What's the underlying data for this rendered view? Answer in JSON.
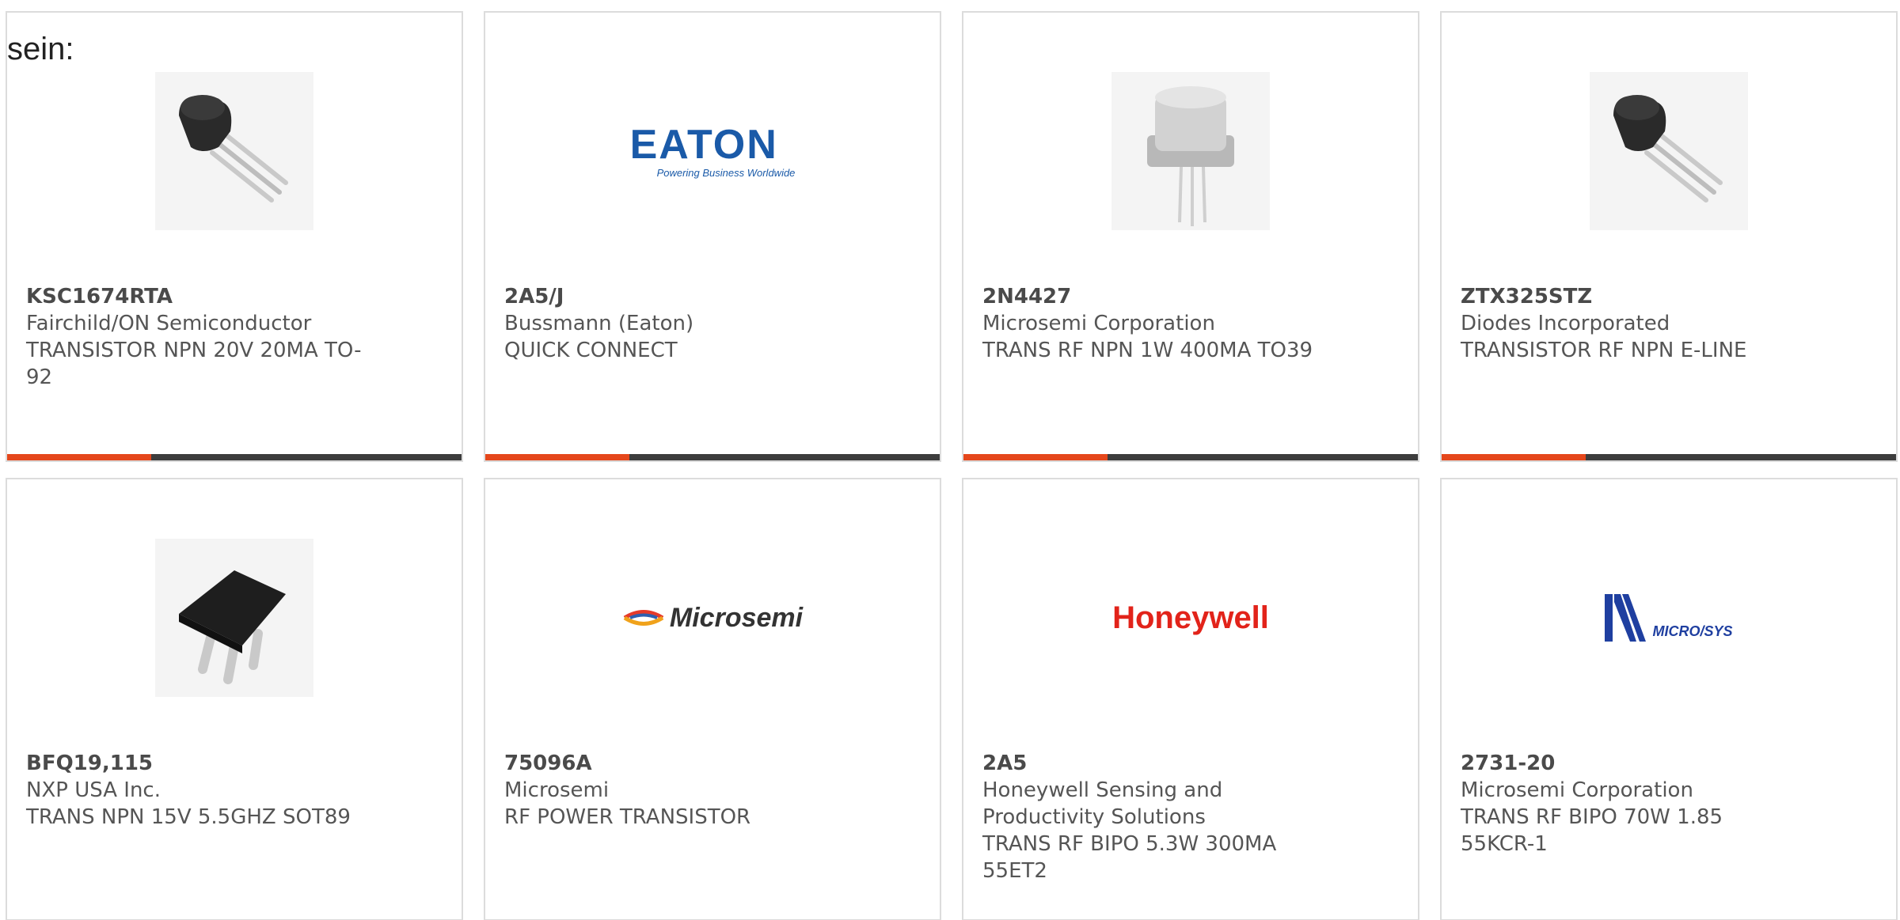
{
  "lead_text": "sein:",
  "colors": {
    "accent": "#e5471b",
    "bar": "#3d3d3d",
    "eaton_blue": "#1a5aa8",
    "honeywell_red": "#e2231a",
    "microsys_blue": "#1f3fa0"
  },
  "products": [
    {
      "part": "KSC1674RTA",
      "manufacturer": "Fairchild/ON Semiconductor",
      "description": "TRANSISTOR NPN 20V 20MA TO-92",
      "image": "to92-transistor-photo"
    },
    {
      "part": "2A5/J",
      "manufacturer": "Bussmann (Eaton)",
      "description": "QUICK CONNECT",
      "image": "eaton-logo",
      "logo_text": "EATON",
      "logo_tagline": "Powering Business Worldwide"
    },
    {
      "part": "2N4427",
      "manufacturer": "Microsemi Corporation",
      "description": "TRANS RF NPN 1W 400MA TO39",
      "image": "to39-transistor-photo"
    },
    {
      "part": "ZTX325STZ",
      "manufacturer": "Diodes Incorporated",
      "description": "TRANSISTOR RF NPN E-LINE",
      "image": "to92-transistor-photo"
    },
    {
      "part": "BFQ19,115",
      "manufacturer": "NXP USA Inc.",
      "description": "TRANS NPN 15V 5.5GHZ SOT89",
      "image": "sot89-transistor-photo"
    },
    {
      "part": "75096A",
      "manufacturer": "Microsemi",
      "description": "RF POWER TRANSISTOR",
      "image": "microsemi-logo",
      "logo_text": "Microsemi"
    },
    {
      "part": "2A5",
      "manufacturer": "Honeywell Sensing and Productivity Solutions",
      "description": "TRANS RF BIPO 5.3W 300MA 55ET2",
      "image": "honeywell-logo",
      "logo_text": "Honeywell"
    },
    {
      "part": "2731-20",
      "manufacturer": "Microsemi Corporation",
      "description": "TRANS RF BIPO 70W 1.85 55KCR-1",
      "image": "microsys-logo",
      "logo_text": "MICRO/SYS"
    }
  ]
}
